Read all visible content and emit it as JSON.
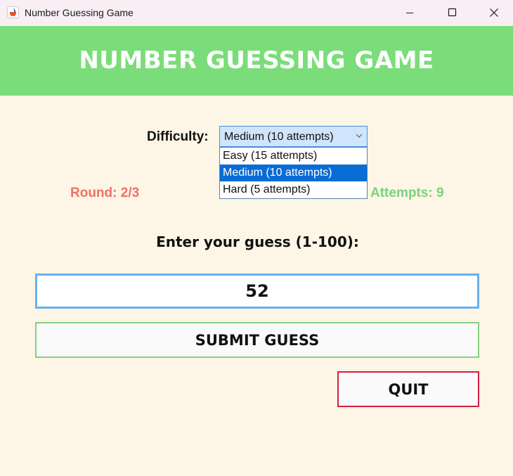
{
  "window": {
    "title": "Number Guessing Game",
    "icon": "java-cup-icon",
    "controls": [
      "minimize-icon",
      "maximize-icon",
      "close-icon"
    ]
  },
  "header": {
    "title": "NUMBER GUESSING GAME",
    "background_color": "#7add79"
  },
  "difficulty": {
    "label": "Difficulty:",
    "selected": "Medium (10 attempts)",
    "dropdown_open": true,
    "options": [
      {
        "label": "Easy (15 attempts)",
        "highlighted": false
      },
      {
        "label": "Medium (10 attempts)",
        "highlighted": true
      },
      {
        "label": "Hard (5 attempts)",
        "highlighted": false
      }
    ]
  },
  "status": {
    "round": "Round: 2/3",
    "round_color": "#f07065",
    "attempts": "Attempts: 9",
    "attempts_color": "#7cd27a"
  },
  "guess": {
    "prompt": "Enter your guess (1-100):",
    "value": "52"
  },
  "buttons": {
    "submit_label": "SUBMIT GUESS",
    "quit_label": "QUIT"
  },
  "colors": {
    "page_background": "#fdf5e6",
    "highlight": "#0a6cd6",
    "input_border": "#6ab0ee",
    "submit_border": "#85d084",
    "quit_border": "#d41e45"
  }
}
